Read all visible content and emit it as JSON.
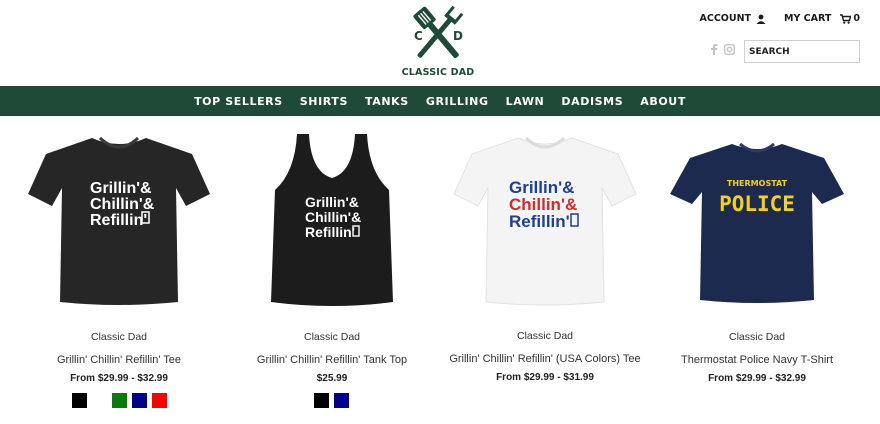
{
  "brand": {
    "logo_initials_left": "C",
    "logo_initials_right": "D",
    "logo_text": "CLASSIC DAD",
    "brand_color": "#1f4a37"
  },
  "account_bar": {
    "account_label": "ACCOUNT",
    "account_icon": "user-icon",
    "cart_label": "MY CART",
    "cart_icon": "cart-icon",
    "cart_count": "0"
  },
  "social": {
    "icons": [
      "facebook-icon",
      "instagram-icon"
    ]
  },
  "search": {
    "placeholder": "SEARCH"
  },
  "nav": {
    "items": [
      {
        "label": "TOP SELLERS"
      },
      {
        "label": "SHIRTS"
      },
      {
        "label": "TANKS"
      },
      {
        "label": "GRILLING"
      },
      {
        "label": "LAWN"
      },
      {
        "label": "DADISMS"
      },
      {
        "label": "ABOUT"
      }
    ]
  },
  "products": [
    {
      "vendor": "Classic Dad",
      "title": "Grillin' Chillin' Refillin' Tee",
      "price": "From $29.99 - $32.99",
      "print_lines": [
        "Grillin'&",
        "Chillin'&",
        "Refillin'"
      ],
      "garment_color": "#262626",
      "swatches": [
        "#000000",
        "#ffffff",
        "#0a7a0a",
        "#00008b",
        "#ff0000"
      ]
    },
    {
      "vendor": "Classic Dad",
      "title": "Grillin' Chillin' Refillin' Tank Top",
      "price": "$25.99",
      "print_lines": [
        "Grillin'&",
        "Chillin'&",
        "Refillin'"
      ],
      "garment_color": "#1c1c1c",
      "swatches": [
        "#000000",
        "#00008b"
      ]
    },
    {
      "vendor": "Classic Dad",
      "title": "Grillin' Chillin' Refillin' (USA Colors) Tee",
      "price": "From $29.99 - $31.99",
      "print_lines": [
        "Grillin'&",
        "Chillin'&",
        "Refillin'"
      ],
      "garment_color": "#f4f4f4",
      "swatches": []
    },
    {
      "vendor": "Classic Dad",
      "title": "Thermostat Police Navy T-Shirt",
      "price": "From $29.99 - $32.99",
      "print_lines": [
        "THERMOSTAT",
        "POLICE"
      ],
      "garment_color": "#1c2a4f",
      "swatches": []
    }
  ]
}
